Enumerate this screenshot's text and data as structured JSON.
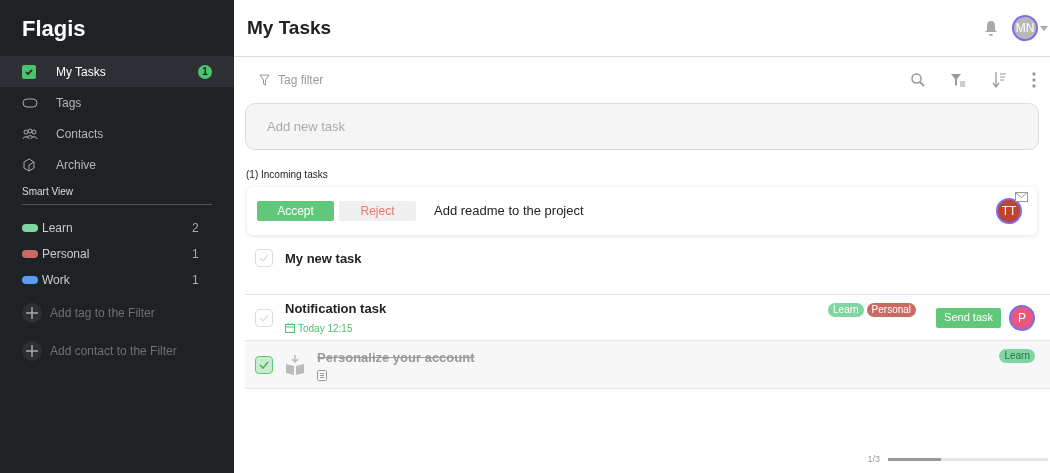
{
  "app": {
    "logo": "Flagis"
  },
  "sidebar": {
    "items": [
      {
        "label": "My Tasks",
        "selected": true,
        "badge": "1"
      },
      {
        "label": "Tags",
        "selected": false
      },
      {
        "label": "Contacts",
        "selected": false
      },
      {
        "label": "Archive",
        "selected": false
      }
    ],
    "section": "Smart View",
    "tags": [
      {
        "label": "Learn",
        "count": "2",
        "color": "#7fd6a0"
      },
      {
        "label": "Personal",
        "count": "1",
        "color": "#c96a63"
      },
      {
        "label": "Work",
        "count": "1",
        "color": "#5a9cf0"
      }
    ],
    "actions": [
      "Add tag to the Filter",
      "Add contact to the Filter"
    ]
  },
  "header": {
    "title": "My Tasks",
    "avatar": "MN"
  },
  "toolbar": {
    "filter_placeholder": "Tag filter"
  },
  "new_task": {
    "placeholder": "Add new task"
  },
  "incoming": {
    "heading": "(1) Incoming tasks",
    "accept": "Accept",
    "reject": "Reject",
    "task": "Add readme to the project",
    "avatar": "TT"
  },
  "tasks": [
    {
      "title": "My new task",
      "checked": false
    },
    {
      "title": "Notification task",
      "checked": false,
      "date": "Today 12:15",
      "tags": [
        {
          "label": "Learn",
          "color": "#7fd6a0"
        },
        {
          "label": "Personal",
          "color": "#c96a63"
        }
      ],
      "send": "Send task",
      "avatar": "P"
    },
    {
      "title": "Personalize your account",
      "checked": true,
      "package_icon": true,
      "note": true,
      "tags": [
        {
          "label": "Learn",
          "color": "#7fd6a0"
        }
      ]
    }
  ],
  "pager": {
    "text": "1/3",
    "level": 0.33
  }
}
